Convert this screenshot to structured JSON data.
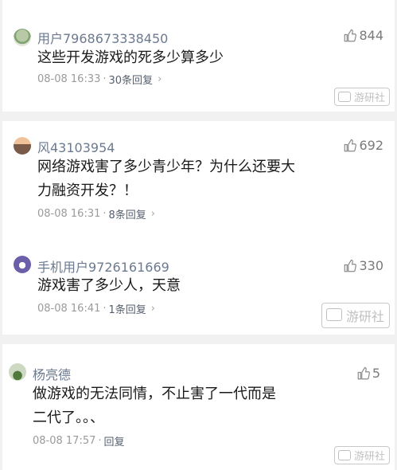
{
  "comments": [
    {
      "username": "用户7968673338450",
      "likes": "844",
      "text_lines": [
        "这些开发游戏的死多少算多少"
      ],
      "time": "08-08 16:33",
      "dot": "·",
      "replies": "30条回复",
      "chevron": "›"
    },
    {
      "username": "风43103954",
      "likes": "692",
      "text_lines": [
        "网络游戏害了多少青少年？为什么还要大",
        "力融资开发？！"
      ],
      "time": "08-08 16:31",
      "dot": "·",
      "replies": "8条回复",
      "chevron": "›"
    },
    {
      "username": "手机用户9726161669",
      "likes": "330",
      "text_lines": [
        "游戏害了多少人，天意"
      ],
      "time": "08-08 16:41",
      "dot": "·",
      "replies": "1条回复",
      "chevron": "›"
    },
    {
      "username": "杨亮德",
      "likes": "5",
      "text_lines": [
        "做游戏的无法同情，不止害了一代而是",
        "二代了。。、"
      ],
      "time": "08-08 17:57",
      "dot": "·",
      "replies": "回复",
      "chevron": ""
    }
  ],
  "watermark": "游研社",
  "icons": {
    "like": "thumbs-up-icon",
    "watermark": "youyanshe-logo-icon"
  }
}
